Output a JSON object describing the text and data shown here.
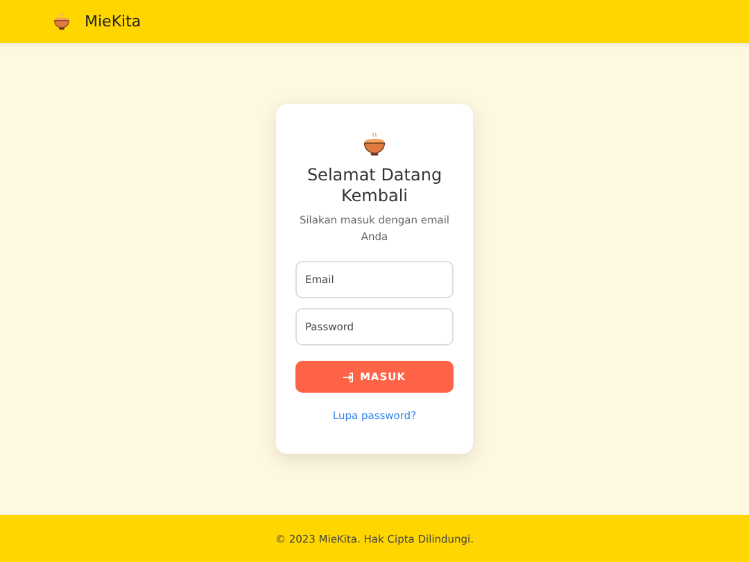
{
  "header": {
    "brand": "MieKita"
  },
  "login": {
    "title": "Selamat Datang Kembali",
    "subtitle": "Silakan masuk dengan email Anda",
    "fields": [
      {
        "placeholder": "Email"
      },
      {
        "placeholder": "Password"
      }
    ],
    "button": "MASUK",
    "link": "Lupa password?"
  },
  "footer": {
    "text": "© 2023 MieKita. Hak Cipta Dilindungi."
  }
}
